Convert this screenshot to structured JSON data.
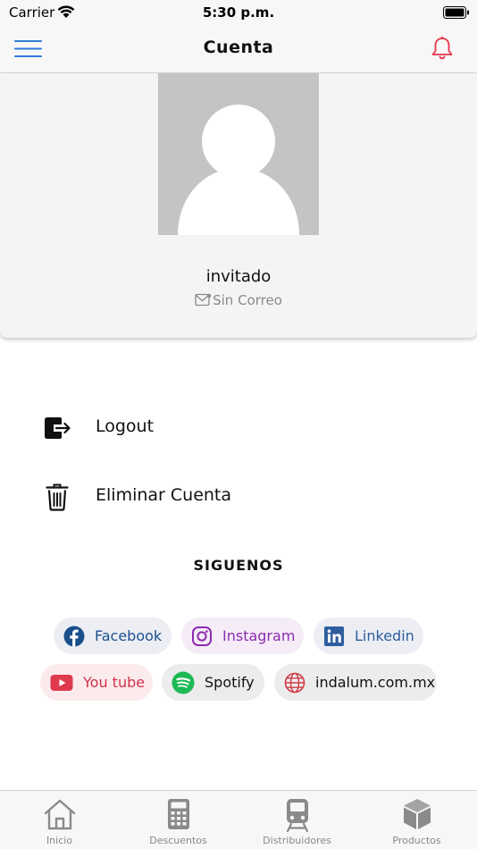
{
  "status_bar": {
    "carrier": "Carrier",
    "time": "5:30 p.m."
  },
  "header": {
    "title": "Cuenta"
  },
  "profile": {
    "name": "invitado",
    "email": "Sin Correo"
  },
  "menu": {
    "logout_label": "Logout",
    "delete_label": "Eliminar Cuenta"
  },
  "social": {
    "title": "SIGUENOS",
    "links": {
      "facebook": "Facebook",
      "instagram": "Instagram",
      "linkedin": "Linkedin",
      "youtube": "You tube",
      "spotify": "Spotify",
      "website": "indalum.com.mx"
    }
  },
  "tabs": [
    {
      "label": "Inicio",
      "icon": "home-icon"
    },
    {
      "label": "Descuentos",
      "icon": "calculator-icon"
    },
    {
      "label": "Distribuidores",
      "icon": "train-icon"
    },
    {
      "label": "Productos",
      "icon": "box-icon"
    }
  ],
  "colors": {
    "accent_blue": "#2f7bd6",
    "bell_red": "#e8334a",
    "facebook": "#1877f2",
    "instagram": "#8e2bb0",
    "linkedin": "#2f5e9f",
    "youtube": "#e03a4f",
    "spotify": "#1db954",
    "website": "#d23a45"
  }
}
